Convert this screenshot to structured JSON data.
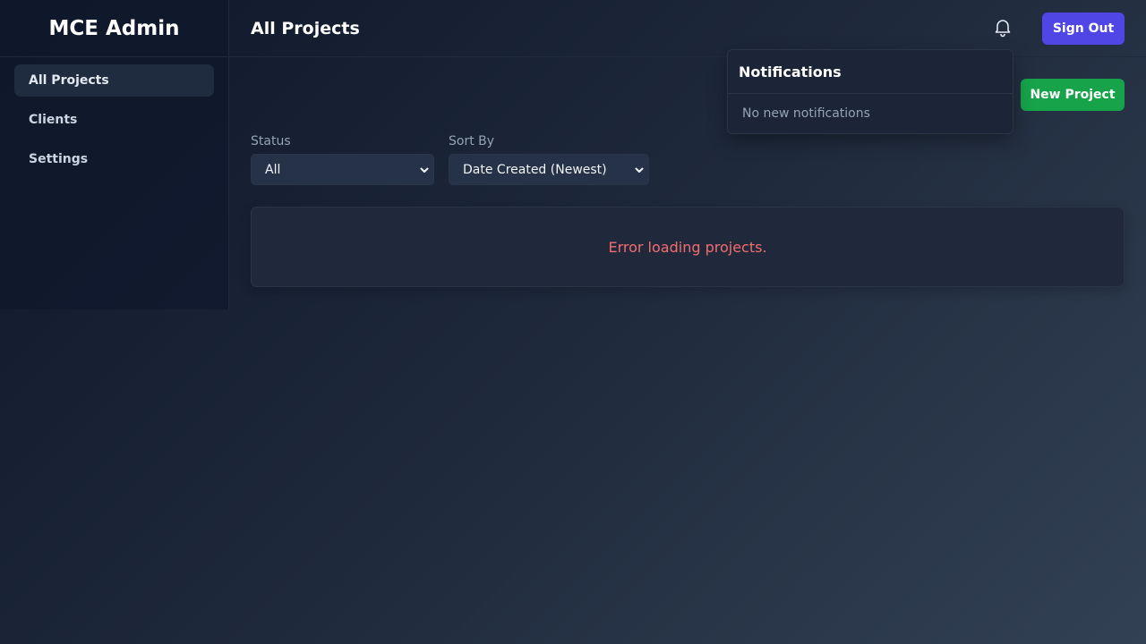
{
  "sidebar": {
    "brand": "MCE Admin",
    "items": [
      {
        "label": "All Projects",
        "active": true
      },
      {
        "label": "Clients",
        "active": false
      },
      {
        "label": "Settings",
        "active": false
      }
    ]
  },
  "header": {
    "title": "All Projects",
    "sign_out_label": "Sign Out",
    "bell_icon": "bell-icon"
  },
  "notifications": {
    "title": "Notifications",
    "empty_text": "No new notifications"
  },
  "actions": {
    "new_project_label": "New Project"
  },
  "filters": {
    "status": {
      "label": "Status",
      "value": "All"
    },
    "sort": {
      "label": "Sort By",
      "value": "Date Created (Newest)"
    }
  },
  "main": {
    "error_text": "Error loading projects."
  },
  "colors": {
    "primary": "#5046e5",
    "success": "#16a34a",
    "error": "#f26d6d"
  }
}
